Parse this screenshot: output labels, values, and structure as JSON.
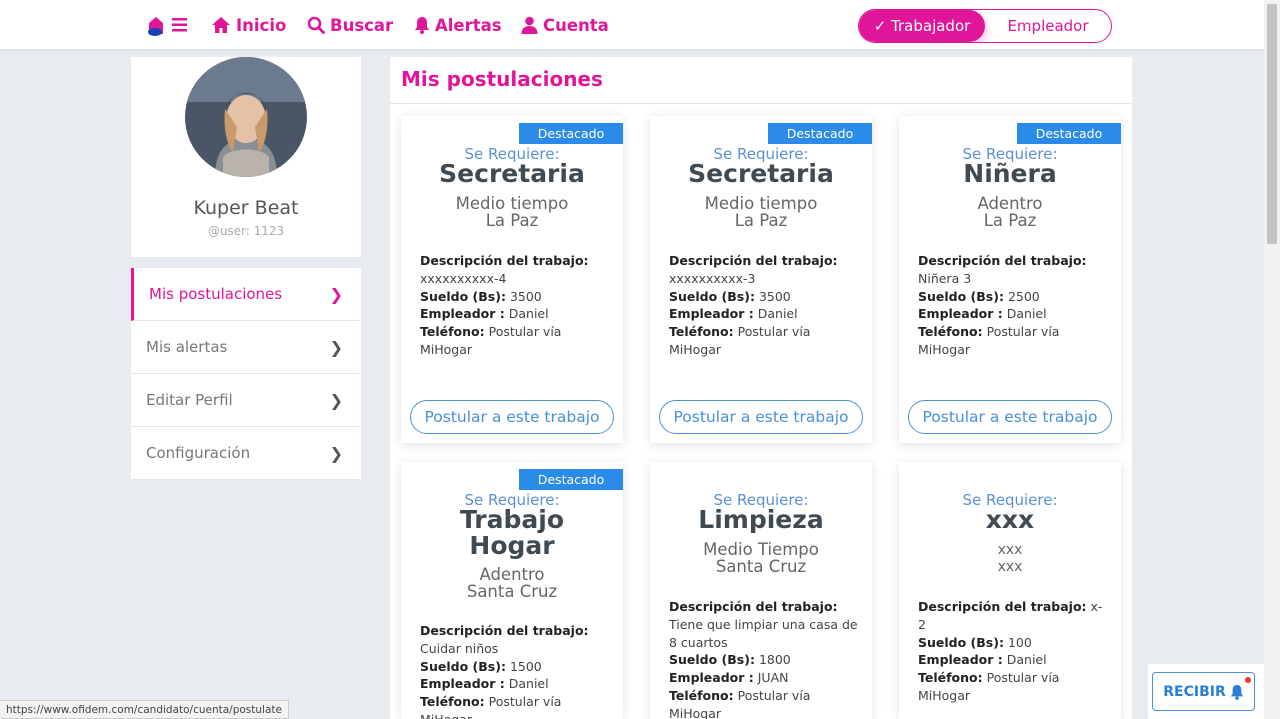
{
  "nav": {
    "items": [
      {
        "label": "Inicio",
        "icon": "home-icon"
      },
      {
        "label": "Buscar",
        "icon": "search-icon"
      },
      {
        "label": "Alertas",
        "icon": "bell-icon"
      },
      {
        "label": "Cuenta",
        "icon": "user-icon"
      }
    ],
    "role_active": "✓ Trabajador",
    "role_inactive": "Empleador"
  },
  "profile": {
    "name": "Kuper Beat",
    "username": "@user: 1123"
  },
  "sidebar": {
    "items": [
      {
        "label": "Mis postulaciones",
        "active": true
      },
      {
        "label": "Mis alertas",
        "active": false
      },
      {
        "label": "Editar Perfil",
        "active": false
      },
      {
        "label": "Configuración",
        "active": false
      }
    ]
  },
  "main": {
    "title": "Mis postulaciones",
    "cards": [
      {
        "badge": "Destacado",
        "requires": "Se Requiere:",
        "job": "Secretaria",
        "line1": "Medio tiempo",
        "line2": "La Paz",
        "desc_label": "Descripción del trabajo:",
        "desc": "xxxxxxxxxx-4",
        "salary_label": "Sueldo (Bs):",
        "salary": "3500",
        "employer_label": "Empleador :",
        "employer": "Daniel",
        "phone_label": "Teléfono:",
        "phone": "Postular vía MiHogar",
        "button": "Postular a este trabajo"
      },
      {
        "badge": "Destacado",
        "requires": "Se Requiere:",
        "job": "Secretaria",
        "line1": "Medio tiempo",
        "line2": "La Paz",
        "desc_label": "Descripción del trabajo:",
        "desc": "xxxxxxxxxx-3",
        "salary_label": "Sueldo (Bs):",
        "salary": "3500",
        "employer_label": "Empleador :",
        "employer": "Daniel",
        "phone_label": "Teléfono:",
        "phone": "Postular vía MiHogar",
        "button": "Postular a este trabajo"
      },
      {
        "badge": "Destacado",
        "requires": "Se Requiere:",
        "job": "Niñera",
        "line1": "Adentro",
        "line2": "La Paz",
        "desc_label": "Descripción del trabajo:",
        "desc": "Niñera 3",
        "salary_label": "Sueldo (Bs):",
        "salary": "2500",
        "employer_label": "Empleador :",
        "employer": "Daniel",
        "phone_label": "Teléfono:",
        "phone": "Postular vía MiHogar",
        "button": "Postular a este trabajo"
      },
      {
        "badge": "Destacado",
        "requires": "Se Requiere:",
        "job": "Trabajo Hogar",
        "line1": "Adentro",
        "line2": "Santa Cruz",
        "desc_label": "Descripción del trabajo:",
        "desc": "Cuidar niños",
        "salary_label": "Sueldo (Bs):",
        "salary": "1500",
        "employer_label": "Empleador :",
        "employer": "Daniel",
        "phone_label": "Teléfono:",
        "phone": "Postular vía MiHogar"
      },
      {
        "badge": "",
        "requires": "Se Requiere:",
        "job": "Limpieza",
        "line1": "Medio Tiempo",
        "line2": "Santa Cruz",
        "desc_label": "Descripción del trabajo:",
        "desc": "Tiene que limpiar una casa de 8 cuartos",
        "salary_label": "Sueldo (Bs):",
        "salary": "1800",
        "employer_label": "Empleador :",
        "employer": "JUAN",
        "phone_label": "Teléfono:",
        "phone": "Postular vía MiHogar"
      },
      {
        "badge": "",
        "requires": "Se Requiere:",
        "job": "xxx",
        "line1": "xxx",
        "line2": "xxx",
        "desc_label": "Descripción del trabajo:",
        "desc": "x-2",
        "salary_label": "Sueldo (Bs):",
        "salary": "100",
        "employer_label": "Empleador :",
        "employer": "Daniel",
        "phone_label": "Teléfono:",
        "phone": "Postular vía MiHogar"
      }
    ]
  },
  "status_url": "https://www.ofidem.com/candidato/cuenta/postulate",
  "recibir": "RECIBIR",
  "colors": {
    "brand": "#e0169a",
    "accent_blue": "#2a8ce8",
    "button_blue": "#4a90d9"
  }
}
